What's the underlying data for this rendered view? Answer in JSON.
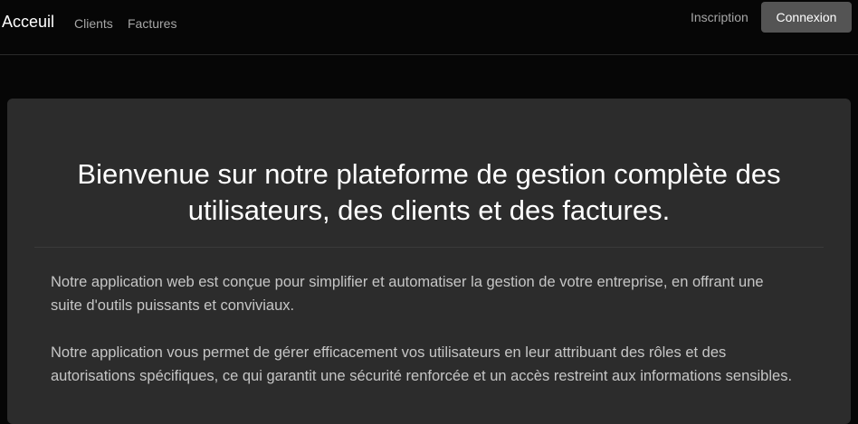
{
  "nav": {
    "brand": "Acceuil",
    "links": [
      {
        "label": "Clients"
      },
      {
        "label": "Factures"
      }
    ],
    "inscription": "Inscription",
    "connexion": "Connexion"
  },
  "main": {
    "title": "Bienvenue sur notre plateforme de gestion complète des utilisateurs, des clients et des factures.",
    "paragraphs": [
      "Notre application web est conçue pour simplifier et automatiser la gestion de votre entreprise, en offrant une suite d'outils puissants et conviviaux.",
      "Notre application vous permet de gérer efficacement vos utilisateurs en leur attribuant des rôles et des autorisations spécifiques, ce qui garantit une sécurité renforcée et un accès restreint aux informations sensibles."
    ]
  },
  "colors": {
    "background": "#060606",
    "card": "#2c2c2c",
    "button": "#545454"
  }
}
